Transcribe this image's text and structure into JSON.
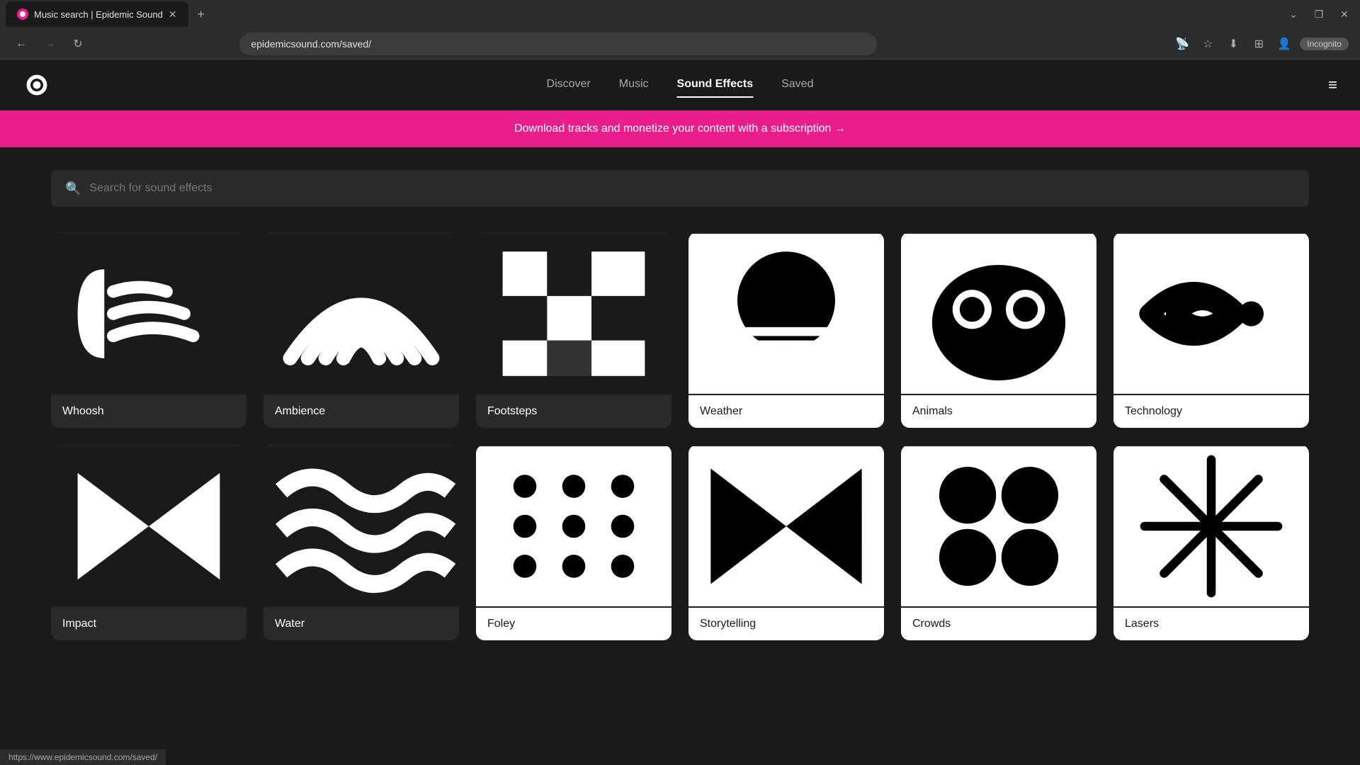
{
  "browser": {
    "tab_title": "Music search | Epidemic Sound",
    "url": "epidemicsound.com/saved/",
    "new_tab_label": "+",
    "incognito_label": "Incognito",
    "status_url": "https://www.epidemicsound.com/saved/"
  },
  "nav": {
    "links": [
      {
        "id": "discover",
        "label": "Discover",
        "active": false
      },
      {
        "id": "music",
        "label": "Music",
        "active": false
      },
      {
        "id": "sound-effects",
        "label": "Sound Effects",
        "active": true
      },
      {
        "id": "saved",
        "label": "Saved",
        "active": false
      }
    ]
  },
  "banner": {
    "text": "Download tracks and monetize your content with a subscription →"
  },
  "search": {
    "placeholder": "Search for sound effects"
  },
  "categories": [
    {
      "id": "whoosh",
      "label": "Whoosh"
    },
    {
      "id": "ambience",
      "label": "Ambience"
    },
    {
      "id": "footsteps",
      "label": "Footsteps"
    },
    {
      "id": "weather",
      "label": "Weather"
    },
    {
      "id": "animals",
      "label": "Animals"
    },
    {
      "id": "technology",
      "label": "Technology"
    },
    {
      "id": "impact",
      "label": "Impact"
    },
    {
      "id": "water",
      "label": "Water"
    },
    {
      "id": "foley",
      "label": "Foley"
    },
    {
      "id": "storytelling",
      "label": "Storytelling"
    },
    {
      "id": "crowds",
      "label": "Crowds"
    },
    {
      "id": "lasers",
      "label": "Lasers"
    }
  ]
}
